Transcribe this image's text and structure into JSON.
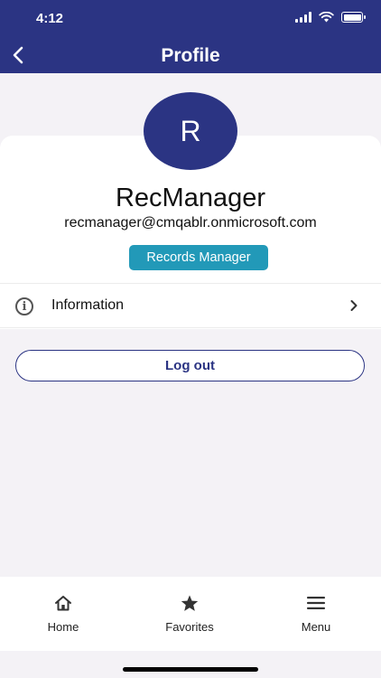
{
  "status_bar": {
    "time": "4:12"
  },
  "header": {
    "title": "Profile"
  },
  "profile": {
    "avatar_initial": "R",
    "name": "RecManager",
    "email": "recmanager@cmqablr.onmicrosoft.com",
    "role": "Records Manager"
  },
  "menu": {
    "information_label": "Information"
  },
  "actions": {
    "logout_label": "Log out"
  },
  "tabbar": {
    "items": [
      {
        "label": "Home",
        "icon": "home-icon"
      },
      {
        "label": "Favorites",
        "icon": "star-icon"
      },
      {
        "label": "Menu",
        "icon": "hamburger-menu-icon"
      }
    ]
  },
  "colors": {
    "primary": "#2b3483",
    "accent": "#2299b8",
    "background": "#f4f2f6"
  }
}
